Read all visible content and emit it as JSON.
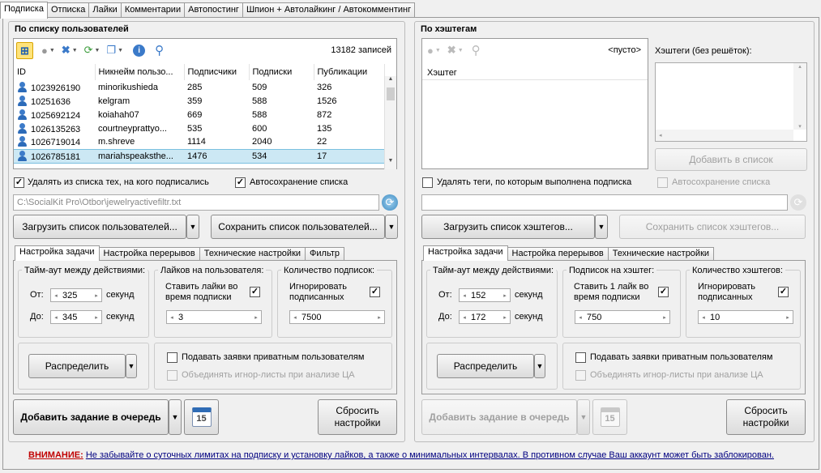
{
  "tabs": [
    "Подписка",
    "Отписка",
    "Лайки",
    "Комментарии",
    "Автопостинг",
    "Шпион + Автолайкинг / Автокомментинг"
  ],
  "left": {
    "title": "По списку пользователей",
    "count": "13182 записей",
    "columns": [
      "ID",
      "Никнейм пользо...",
      "Подписчики",
      "Подписки",
      "Публикации"
    ],
    "rows": [
      [
        "1023926190",
        "minorikushieda",
        "285",
        "509",
        "326"
      ],
      [
        "1025163​6",
        "kelgram",
        "359",
        "588",
        "1526"
      ],
      [
        "1025692124",
        "koiahah07",
        "669",
        "588",
        "872"
      ],
      [
        "1026135263",
        "courtneyprattyo...",
        "535",
        "600",
        "135"
      ],
      [
        "1026719014",
        "m.shreve",
        "1114",
        "2040",
        "22"
      ],
      [
        "1026785181",
        "mariahspeaksthe...",
        "1476",
        "534",
        "17"
      ]
    ],
    "chk_delete": "Удалять из списка тех, на кого подписались",
    "chk_autosave": "Автосохранение списка",
    "path": "C:\\SocialKit Pro\\Otbor\\jewelryactivefiltr.txt",
    "load_btn": "Загрузить список пользователей...",
    "save_btn": "Сохранить список пользователей...",
    "subtabs": [
      "Настройка задачи",
      "Настройка перерывов",
      "Технические настройки",
      "Фильтр"
    ],
    "timeout_title": "Тайм-аут между действиями:",
    "from_lbl": "От:",
    "to_lbl": "До:",
    "from_val": "325",
    "to_val": "345",
    "sec": "секунд",
    "likes_title": "Лайков на пользователя:",
    "likes_chk": "Ставить лайки во время подписки",
    "likes_val": "3",
    "count_title": "Количество подписок:",
    "ignore_chk": "Игнорировать подписанных",
    "count_val": "7500",
    "distribute": "Распределить",
    "private_chk": "Подавать заявки приватным пользователям",
    "merge_chk": "Объединять игнор-листы при анализе ЦА",
    "add_task": "Добавить задание в очередь",
    "reset": "Сбросить настройки",
    "cal_day": "15"
  },
  "right": {
    "title": "По хэштегам",
    "empty": "<пусто>",
    "column": "Хэштег",
    "hashtags_lbl": "Хэштеги (без решёток):",
    "add_list": "Добавить в список",
    "chk_delete": "Удалять теги, по которым выполнена подписка",
    "chk_autosave": "Автосохранение списка",
    "load_btn": "Загрузить список хэштегов...",
    "save_btn": "Сохранить список хэштегов...",
    "subtabs": [
      "Настройка задачи",
      "Настройка перерывов",
      "Технические настройки"
    ],
    "timeout_title": "Тайм-аут между действиями:",
    "from_lbl": "От:",
    "to_lbl": "До:",
    "from_val": "152",
    "to_val": "172",
    "sec": "секунд",
    "per_tag_title": "Подписок на хэштег:",
    "likes_chk": "Ставить 1 лайк во время подписки",
    "per_tag_val": "750",
    "count_title": "Количество хэштегов:",
    "ignore_chk": "Игнорировать подписанных",
    "count_val": "10",
    "distribute": "Распределить",
    "private_chk": "Подавать заявки приватным пользователям",
    "merge_chk": "Объединять игнор-листы при анализе ЦА",
    "add_task": "Добавить задание в очередь",
    "reset": "Сбросить настройки",
    "cal_day": "15"
  },
  "warning": {
    "label": "ВНИМАНИЕ:",
    "message": "Не забывайте о суточных лимитах на подписку и установку лайков, а также о минимальных интервалах. В противном случае Ваш аккаунт может быть заблокирован."
  }
}
